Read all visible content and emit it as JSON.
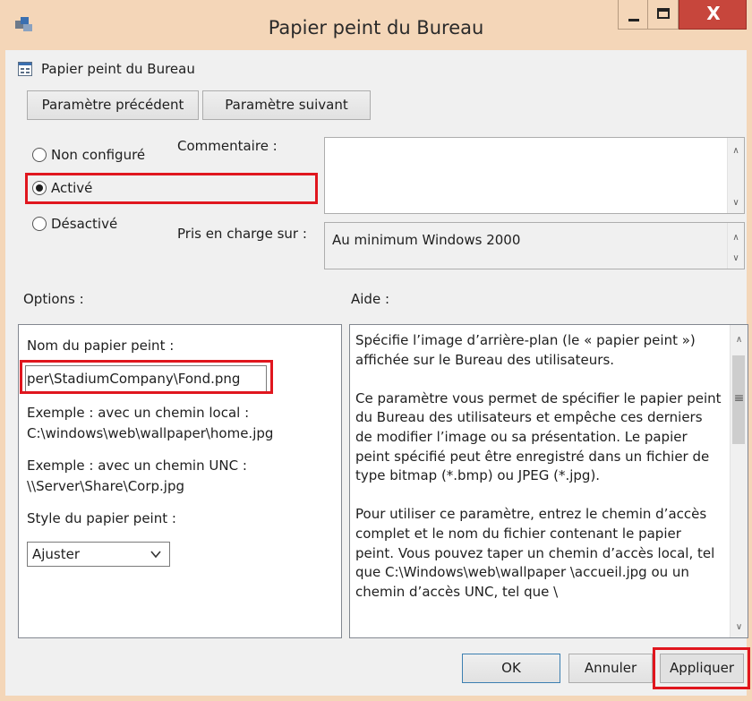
{
  "window": {
    "title": "Papier peint du Bureau",
    "close_glyph": "X",
    "icons": {
      "app": "group-policy-icon",
      "minimize": "minimize-icon",
      "maximize": "maximize-icon",
      "close": "close-icon"
    }
  },
  "policy": {
    "title": "Papier peint du Bureau",
    "icon": "policy-setting-icon"
  },
  "nav": {
    "previous_label": "Paramètre précédent",
    "next_label": "Paramètre suivant"
  },
  "state": {
    "options": [
      {
        "label": "Non configuré",
        "checked": false
      },
      {
        "label": "Activé",
        "checked": true
      },
      {
        "label": "Désactivé",
        "checked": false
      }
    ]
  },
  "comment": {
    "label": "Commentaire :",
    "value": ""
  },
  "supported": {
    "label": "Pris en charge sur :",
    "value": "Au minimum Windows 2000"
  },
  "options_section": {
    "header": "Options :",
    "wallpaper_name_label": "Nom du papier peint :",
    "wallpaper_name_value": "per\\StadiumCompany\\Fond.png",
    "example_local_label": "Exemple : avec un chemin local :",
    "example_local_value": "C:\\windows\\web\\wallpaper\\home.jpg",
    "example_unc_label": "Exemple : avec un chemin UNC :",
    "example_unc_value": "\\\\Server\\Share\\Corp.jpg",
    "style_label": "Style du papier peint :",
    "style_value": "Ajuster"
  },
  "help": {
    "header": "Aide :",
    "paragraphs": [
      "Spécifie l’image d’arrière-plan (le « papier peint ») affichée sur le Bureau des utilisateurs.",
      "Ce paramètre vous permet de spécifier le papier peint du Bureau des utilisateurs et empêche ces derniers de modifier l’image ou sa présentation. Le papier peint spécifié peut être enregistré dans un fichier de type bitmap (*.bmp) ou JPEG (*.jpg).",
      "Pour utiliser ce paramètre, entrez le chemin d’accès complet et le nom du fichier contenant le papier peint. Vous pouvez taper un chemin d’accès local, tel que C:\\Windows\\web\\wallpaper \\accueil.jpg ou un chemin d’accès UNC, tel que \\"
    ]
  },
  "footer": {
    "ok_label": "OK",
    "cancel_label": "Annuler",
    "apply_label": "Appliquer"
  },
  "colors": {
    "highlight": "#e0161e",
    "titlebar": "#f4d6b8",
    "close_button": "#c7463c"
  }
}
